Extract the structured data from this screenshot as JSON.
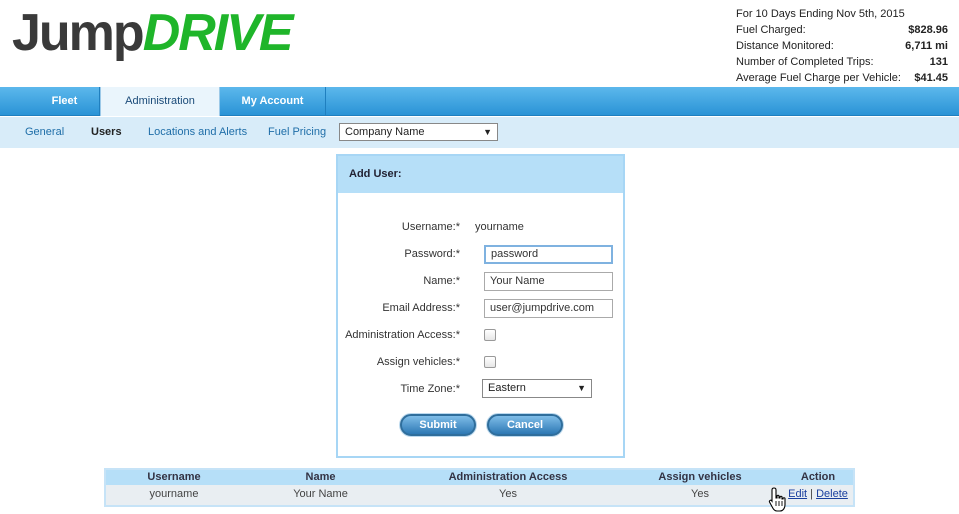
{
  "app": {
    "logo_left": "Jump",
    "logo_right": "DRIVE",
    "brand_green": "#1fb52a",
    "brand_gray": "#3a3a3a"
  },
  "stats": {
    "period": "For 10 Days Ending Nov 5th, 2015",
    "rows": [
      {
        "label": "Fuel Charged:",
        "value": "$828.96"
      },
      {
        "label": "Distance Monitored:",
        "value": "6,711 mi"
      },
      {
        "label": "Number of Completed Trips:",
        "value": "131"
      },
      {
        "label": "Average Fuel Charge per Vehicle:",
        "value": "$41.45"
      }
    ]
  },
  "nav": {
    "tabs": [
      {
        "label": "Fleet"
      },
      {
        "label": "Administration"
      },
      {
        "label": "My Account"
      }
    ]
  },
  "subnav": {
    "items": [
      {
        "label": "General"
      },
      {
        "label": "Users"
      },
      {
        "label": "Locations and Alerts"
      },
      {
        "label": "Fuel Pricing"
      }
    ],
    "company_select": "Company Name"
  },
  "form": {
    "title": "Add User:",
    "username": {
      "label": "Username:*",
      "value": "yourname"
    },
    "password": {
      "label": "Password:*",
      "value": "password"
    },
    "name": {
      "label": "Name:*",
      "value": "Your Name"
    },
    "email": {
      "label": "Email Address:*",
      "value": "user@jumpdrive.com"
    },
    "admin": {
      "label": "Administration Access:*"
    },
    "assign": {
      "label": "Assign vehicles:*"
    },
    "timezone": {
      "label": "Time Zone:*",
      "value": "Eastern"
    },
    "submit_label": "Submit",
    "cancel_label": "Cancel"
  },
  "table": {
    "headers": [
      "Username",
      "Name",
      "Administration Access",
      "Assign vehicles",
      "Action"
    ],
    "rows": [
      {
        "username": "yourname",
        "name": "Your Name",
        "admin": "Yes",
        "assign": "Yes",
        "edit": "Edit",
        "sep": "|",
        "delete": "Delete"
      }
    ]
  }
}
